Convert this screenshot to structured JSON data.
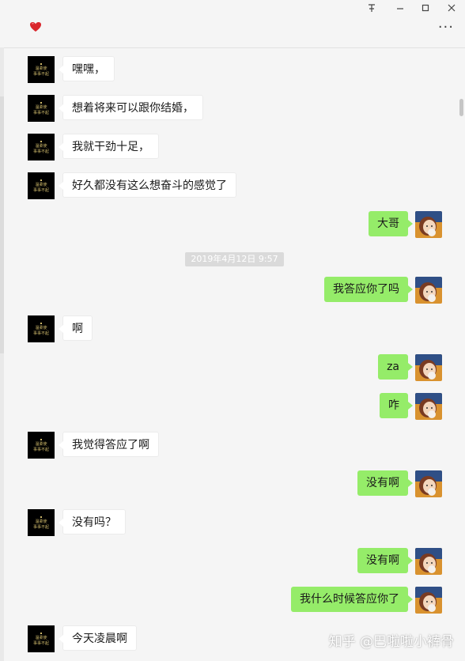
{
  "window": {
    "pin_icon": "pin-icon",
    "minimize_icon": "minimize-icon",
    "maximize_icon": "maximize-icon",
    "close_icon": "close-icon"
  },
  "header": {
    "contact_icon": "heart-icon",
    "more_label": "···"
  },
  "timestamp": "2019年4月12日 9:57",
  "messages": [
    {
      "side": "left",
      "text": "嘿嘿，"
    },
    {
      "side": "left",
      "text": "想着将来可以跟你结婚，"
    },
    {
      "side": "left",
      "text": "我就干劲十足，"
    },
    {
      "side": "left",
      "text": "好久都没有这么想奋斗的感觉了"
    },
    {
      "side": "right",
      "text": "大哥"
    },
    {
      "side": "right",
      "text": "我答应你了吗"
    },
    {
      "side": "left",
      "text": "啊"
    },
    {
      "side": "right",
      "text": "za"
    },
    {
      "side": "right",
      "text": "咋"
    },
    {
      "side": "left",
      "text": "我觉得答应了啊"
    },
    {
      "side": "right",
      "text": "没有啊"
    },
    {
      "side": "left",
      "text": "没有吗？"
    },
    {
      "side": "right",
      "text": "没有啊"
    },
    {
      "side": "right",
      "text": "我什么时候答应你了"
    },
    {
      "side": "left",
      "text": "今天凌晨啊"
    }
  ],
  "watermark": "知乎 @巴啦啦小裤骨",
  "colors": {
    "sent_bubble": "#95ec69",
    "received_bubble": "#ffffff",
    "background": "#f5f5f5"
  }
}
